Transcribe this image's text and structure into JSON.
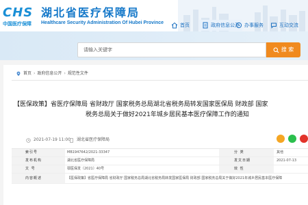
{
  "header": {
    "logo_letters": "CHS",
    "logo_sub": "中国医疗保障",
    "org_name_cn": "湖北省医疗保障局",
    "org_name_en": "Healthcare Security Administration Of Hubei Province"
  },
  "nav": {
    "home": "首页",
    "gov_info": "政府信息公开",
    "service": "办事服务",
    "interact": "互动交流"
  },
  "search": {
    "placeholder": "请输入关键字",
    "button_label": "搜 索"
  },
  "breadcrumb": [
    "首页",
    "政府信息公开",
    "规范性文件"
  ],
  "article": {
    "title_line1": "【医保政策】省医疗保障局 省财政厅 国家税务总局湖北省税务局转发国家医保局 财政部 国家",
    "title_line2": "税务总局关于做好2021年城乡居民基本医疗保障工作的通知",
    "date": "2021-07-19 11:00",
    "source": "湖北省医疗保障局"
  },
  "info_table": {
    "rows": [
      {
        "k": "索引号",
        "v": "MB1947642/2021-33347",
        "k2": "分 类",
        "v2": "其他"
      },
      {
        "k": "发布机构",
        "v": "湖北省医疗保障局",
        "k2": "发文日期",
        "v2": "2021-07-13"
      },
      {
        "k": "文 号",
        "v": "鄂医保发〔2021〕40号",
        "k2": "效 性",
        "v2": ""
      }
    ],
    "summary_key": "内容概述",
    "summary_value": "【医保政策】省医疗保障局 省财政厅 国家税务总局湖北省税务局转发国家医保局 财政部 国家税务总局关于做好2021年城乡居民基本医疗保障"
  },
  "colors": {
    "brand_blue": "#1478c9",
    "search_orange": "#f08a1e",
    "share_orange": "#f5a623",
    "share_green": "#2bbf4d",
    "share_red": "#e2332a"
  }
}
